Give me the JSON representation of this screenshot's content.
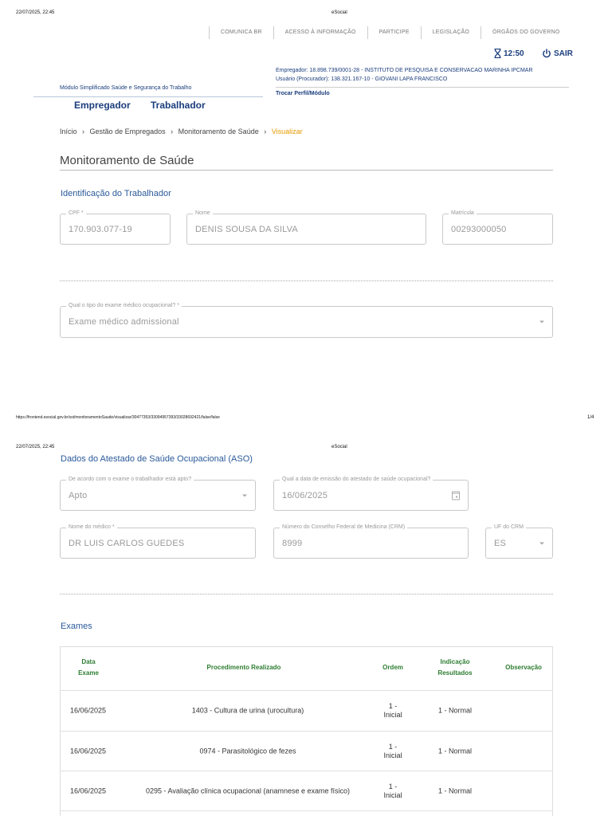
{
  "print_header_1": {
    "datetime": "22/07/2025, 22:45",
    "title": "eSocial"
  },
  "top_nav": [
    "COMUNICA BR",
    "ACESSO À INFORMAÇÃO",
    "PARTICIPE",
    "LEGISLAÇÃO",
    "ÓRGÃOS DO GOVERNO"
  ],
  "session": {
    "time": "12:50",
    "logout": "SAIR"
  },
  "employer_info": {
    "empregador": "Empregador: 18.898.739/0001-28 - INSTITUTO DE PESQUISA E CONSERVACAO MARINHA IPCMAR",
    "usuario": "Usuário (Procurador): 138.321.167-10 - GIOVANI LAPA FRANCISCO",
    "trocar": "Trocar Perfil/Módulo"
  },
  "module": "Módulo Simplificado Saúde e Segurança do Trabalho",
  "tabs": [
    "Empregador",
    "Trabalhador"
  ],
  "breadcrumb": {
    "items": [
      "Início",
      "Gestão de Empregados",
      "Monitoramento de Saúde"
    ],
    "current": "Visualizar",
    "sep": "›"
  },
  "page_title": "Monitoramento de Saúde",
  "worker_section": {
    "title": "Identificação do Trabalhador",
    "cpf": {
      "label": "CPF *",
      "value": "170.903.077-19"
    },
    "nome": {
      "label": "Nome",
      "value": "DENIS SOUSA DA SILVA"
    },
    "matricula": {
      "label": "Matrícula",
      "value": "00293000050"
    }
  },
  "exam_type": {
    "label": "Qual o tipo do exame médico ocupacional? *",
    "value": "Exame médico admissional"
  },
  "footer": {
    "url": "https://frontend.esocial.gov.br/sst/monitoramentoSaude/visualizar/30477353/33094957393/33028692421/false/false",
    "page": "1/4"
  },
  "print_header_2": {
    "datetime": "22/07/2025, 22:45",
    "title": "eSocial"
  },
  "aso_section": {
    "title": "Dados do Atestado de Saúde Ocupacional (ASO)",
    "apto": {
      "label": "De acordo com o exame o trabalhador está apto?",
      "value": "Apto"
    },
    "data_emissao": {
      "label": "Qual a data de emissão do atestado de saúde ocupacional?",
      "value": "16/06/2025"
    },
    "medico": {
      "label": "Nome do médico *",
      "value": "DR LUIS CARLOS GUEDES"
    },
    "crm": {
      "label": "Número do Conselho Federal de Medicina (CRM)",
      "value": "8999"
    },
    "uf_crm": {
      "label": "UF do CRM",
      "value": "ES"
    }
  },
  "exams": {
    "title": "Exames",
    "headers": {
      "data_1": "Data",
      "data_2": "Exame",
      "procedimento": "Procedimento Realizado",
      "ordem": "Ordem",
      "indicacao_1": "Indicação",
      "indicacao_2": "Resultados",
      "observacao": "Observação"
    },
    "rows": [
      {
        "data": "16/06/2025",
        "procedimento": "1403 - Cultura de urina (urocultura)",
        "ordem_1": "1 -",
        "ordem_2": "Inicial",
        "indicacao": "1 - Normal",
        "observacao": ""
      },
      {
        "data": "16/06/2025",
        "procedimento": "0974 - Parasitológico de fezes",
        "ordem_1": "1 -",
        "ordem_2": "Inicial",
        "indicacao": "1 - Normal",
        "observacao": ""
      },
      {
        "data": "16/06/2025",
        "procedimento": "0295 - Avaliação clínica ocupacional (anamnese e exame físico)",
        "ordem_1": "1 -",
        "ordem_2": "Inicial",
        "indicacao": "1 - Normal",
        "observacao": ""
      }
    ]
  }
}
